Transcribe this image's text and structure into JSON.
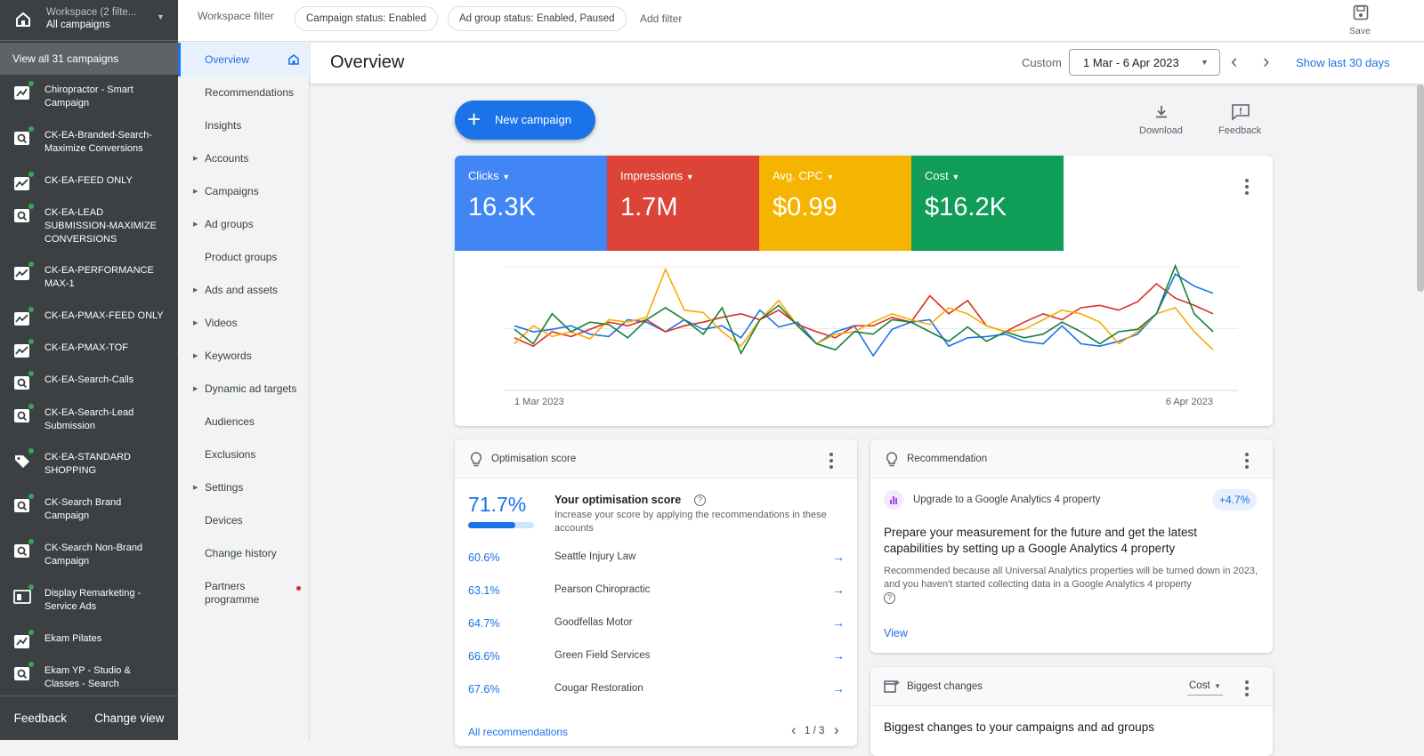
{
  "workspace": {
    "label": "Workspace (2 filte...",
    "sub": "All campaigns"
  },
  "view_all": "View all 31 campaigns",
  "campaigns": [
    {
      "name": "Chiropractor - Smart Campaign",
      "icon": "smart-campaign-icon"
    },
    {
      "name": "CK-EA-Branded-Search-Maximize Conversions",
      "icon": "search-campaign-icon"
    },
    {
      "name": "CK-EA-FEED ONLY",
      "icon": "performance-max-icon"
    },
    {
      "name": "CK-EA-LEAD SUBMISSION-MAXIMIZE CONVERSIONS",
      "icon": "search-campaign-icon"
    },
    {
      "name": "CK-EA-PERFORMANCE MAX-1",
      "icon": "performance-max-icon"
    },
    {
      "name": "CK-EA-PMAX-FEED ONLY",
      "icon": "performance-max-icon"
    },
    {
      "name": "CK-EA-PMAX-TOF",
      "icon": "performance-max-icon"
    },
    {
      "name": "CK-EA-Search-Calls",
      "icon": "search-campaign-icon"
    },
    {
      "name": "CK-EA-Search-Lead Submission",
      "icon": "search-campaign-icon"
    },
    {
      "name": "CK-EA-STANDARD SHOPPING",
      "icon": "shopping-campaign-icon"
    },
    {
      "name": "CK-Search Brand Campaign",
      "icon": "search-campaign-icon"
    },
    {
      "name": "CK-Search Non-Brand Campaign",
      "icon": "search-campaign-icon"
    },
    {
      "name": "Display Remarketing - Service Ads",
      "icon": "display-campaign-icon"
    },
    {
      "name": "Ekam Pilates",
      "icon": "smart-campaign-icon"
    },
    {
      "name": "Ekam YP - Studio & Classes - Search",
      "icon": "search-campaign-icon"
    }
  ],
  "footer": {
    "feedback": "Feedback",
    "change_view": "Change view"
  },
  "topbar": {
    "workspace_filter": "Workspace filter",
    "chip1": "Campaign status: Enabled",
    "chip2": "Ad group status: Enabled, Paused",
    "add_filter": "Add filter",
    "save": "Save"
  },
  "nav": [
    {
      "label": "Overview",
      "expand": false,
      "active": true
    },
    {
      "label": "Recommendations",
      "expand": false
    },
    {
      "label": "Insights",
      "expand": false
    },
    {
      "label": "Accounts",
      "expand": true
    },
    {
      "label": "Campaigns",
      "expand": true
    },
    {
      "label": "Ad groups",
      "expand": true
    },
    {
      "label": "Product groups",
      "expand": false
    },
    {
      "label": "Ads and assets",
      "expand": true
    },
    {
      "label": "Videos",
      "expand": true
    },
    {
      "label": "Keywords",
      "expand": true
    },
    {
      "label": "Dynamic ad targets",
      "expand": true
    },
    {
      "label": "Audiences",
      "expand": false
    },
    {
      "label": "Exclusions",
      "expand": false
    },
    {
      "label": "Settings",
      "expand": true
    },
    {
      "label": "Devices",
      "expand": false
    },
    {
      "label": "Change history",
      "expand": false
    },
    {
      "label": "Partners programme",
      "expand": false,
      "badge": true
    }
  ],
  "header": {
    "title": "Overview",
    "custom": "Custom",
    "date_range": "1 Mar - 6 Apr 2023",
    "show_last": "Show last 30 days"
  },
  "actions": {
    "new_campaign": "New campaign",
    "download": "Download",
    "feedback": "Feedback"
  },
  "metrics": [
    {
      "label": "Clicks",
      "value": "16.3K",
      "color": "#4285f4"
    },
    {
      "label": "Impressions",
      "value": "1.7M",
      "color": "#db4437"
    },
    {
      "label": "Avg. CPC",
      "value": "$0.99",
      "color": "#f4b400"
    },
    {
      "label": "Cost",
      "value": "$16.2K",
      "color": "#0f9d58"
    }
  ],
  "chart_data": {
    "type": "line",
    "x_start": "1 Mar 2023",
    "x_end": "6 Apr 2023",
    "series": [
      {
        "name": "Clicks",
        "color": "#1a73e8",
        "values": [
          0.45,
          0.4,
          0.42,
          0.45,
          0.38,
          0.36,
          0.5,
          0.48,
          0.4,
          0.5,
          0.42,
          0.45,
          0.35,
          0.58,
          0.44,
          0.48,
          0.3,
          0.4,
          0.45,
          0.2,
          0.42,
          0.48,
          0.5,
          0.28,
          0.35,
          0.36,
          0.38,
          0.32,
          0.3,
          0.45,
          0.3,
          0.28,
          0.32,
          0.38,
          0.55,
          0.88,
          0.78,
          0.72
        ]
      },
      {
        "name": "Impressions",
        "color": "#d93025",
        "values": [
          0.35,
          0.28,
          0.4,
          0.36,
          0.42,
          0.48,
          0.45,
          0.5,
          0.4,
          0.45,
          0.48,
          0.52,
          0.55,
          0.5,
          0.58,
          0.46,
          0.4,
          0.35,
          0.45,
          0.45,
          0.52,
          0.48,
          0.7,
          0.55,
          0.66,
          0.45,
          0.4,
          0.48,
          0.55,
          0.5,
          0.6,
          0.62,
          0.58,
          0.65,
          0.8,
          0.68,
          0.62,
          0.55
        ]
      },
      {
        "name": "Avg. CPC",
        "color": "#f9ab00",
        "values": [
          0.3,
          0.45,
          0.36,
          0.4,
          0.34,
          0.5,
          0.48,
          0.52,
          0.92,
          0.58,
          0.56,
          0.4,
          0.28,
          0.5,
          0.66,
          0.45,
          0.3,
          0.38,
          0.4,
          0.48,
          0.55,
          0.5,
          0.46,
          0.6,
          0.55,
          0.45,
          0.4,
          0.42,
          0.5,
          0.58,
          0.55,
          0.48,
          0.3,
          0.4,
          0.55,
          0.6,
          0.4,
          0.25
        ]
      },
      {
        "name": "Cost",
        "color": "#188038",
        "values": [
          0.42,
          0.3,
          0.55,
          0.4,
          0.48,
          0.46,
          0.35,
          0.5,
          0.6,
          0.5,
          0.38,
          0.6,
          0.22,
          0.5,
          0.62,
          0.45,
          0.3,
          0.25,
          0.4,
          0.38,
          0.5,
          0.48,
          0.4,
          0.32,
          0.44,
          0.32,
          0.4,
          0.35,
          0.38,
          0.48,
          0.4,
          0.3,
          0.4,
          0.42,
          0.55,
          0.95,
          0.55,
          0.4
        ]
      }
    ]
  },
  "optimisation": {
    "title": "Optimisation score",
    "score": "71.7%",
    "score_value": 0.717,
    "heading": "Your optimisation score",
    "desc": "Increase your score by applying the recommendations in these accounts",
    "rows": [
      {
        "pct": "60.6%",
        "name": "Seattle Injury Law"
      },
      {
        "pct": "63.1%",
        "name": "Pearson Chiropractic"
      },
      {
        "pct": "64.7%",
        "name": "Goodfellas Motor"
      },
      {
        "pct": "66.6%",
        "name": "Green Field Services"
      },
      {
        "pct": "67.6%",
        "name": "Cougar Restoration"
      }
    ],
    "all_link": "All recommendations",
    "pager": "1 / 3"
  },
  "recommendation": {
    "title": "Recommendation",
    "item": "Upgrade to a Google Analytics 4 property",
    "badge": "+4.7%",
    "headline": "Prepare your measurement for the future and get the latest capabilities by setting up a Google Analytics 4 property",
    "body": "Recommended because all Universal Analytics properties will be turned down in 2023, and you haven't started collecting data in a Google Analytics 4 property",
    "view": "View"
  },
  "biggest": {
    "title": "Biggest changes",
    "metric": "Cost",
    "headline": "Biggest changes to your campaigns and ad groups"
  }
}
